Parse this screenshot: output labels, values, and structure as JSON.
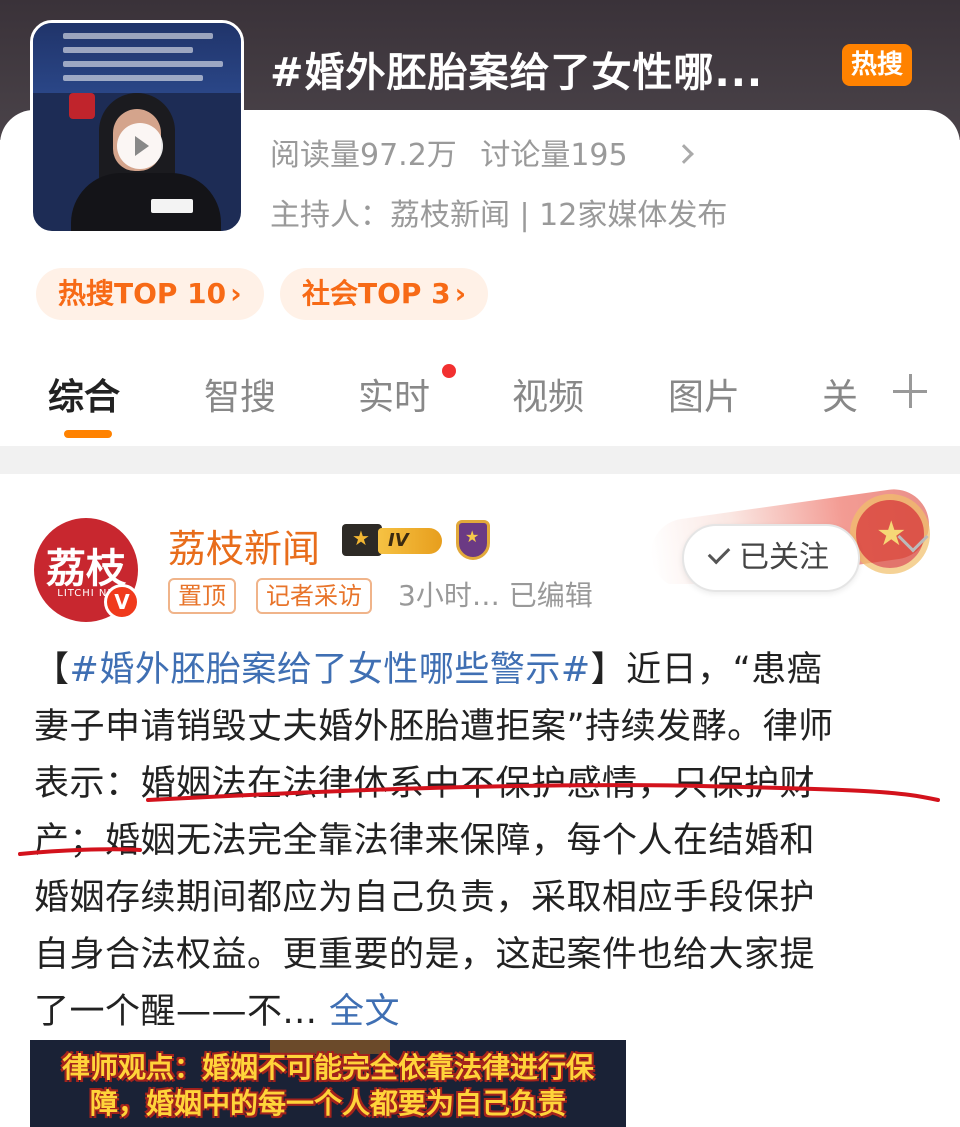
{
  "topic": {
    "title": "#婚外胚胎案给了女性哪...",
    "hot_badge": "热搜",
    "stats": {
      "reads": "阅读量97.2万",
      "discussions": "讨论量195"
    },
    "host_line": "主持人：荔枝新闻 | 12家媒体发布",
    "rank_chips": [
      {
        "label": "热搜TOP 10",
        "arrow": "›"
      },
      {
        "label": "社会TOP 3",
        "arrow": "›"
      }
    ]
  },
  "tabs": {
    "items": [
      {
        "label": "综合",
        "active": true
      },
      {
        "label": "智搜"
      },
      {
        "label": "实时",
        "has_dot": true
      },
      {
        "label": "视频"
      },
      {
        "label": "图片"
      },
      {
        "label": "关"
      }
    ]
  },
  "post": {
    "author": "荔枝新闻",
    "avatar_text": "荔枝",
    "avatar_sub": "LITCHI NE",
    "level_badge": "IV",
    "verified_mark": "V",
    "tags": [
      "置顶",
      "记者采访"
    ],
    "meta": "3小时…  已编辑",
    "follow_label": "已关注",
    "body_lines": [
      {
        "pre": "【",
        "hashtag": "#婚外胚胎案给了女性哪些警示#",
        "post": "】近日，“患癌"
      },
      {
        "text": "妻子申请销毁丈夫婚外胚胎遭拒案”持续发酵。律师"
      },
      {
        "text": "表示：婚姻法在法律体系中不保护感情，只保护财"
      },
      {
        "text": "产；婚姻无法完全靠法律来保障，每个人在结婚和"
      },
      {
        "text": "婚姻存续期间都应为自己负责，采取相应手段保护"
      },
      {
        "text": "自身合法权益。更重要的是，这起案件也给大家提"
      },
      {
        "pre": "了一个醒——不... ",
        "link": "全文"
      }
    ],
    "video_caption_lines": [
      "律师观点：婚姻不可能完全依靠法律进行保",
      "障，婚姻中的每一个人都要为自己负责"
    ]
  },
  "colors": {
    "accent_orange": "#ff8200",
    "link_blue": "#3f6fb3",
    "annotation_red": "#d3121c"
  }
}
